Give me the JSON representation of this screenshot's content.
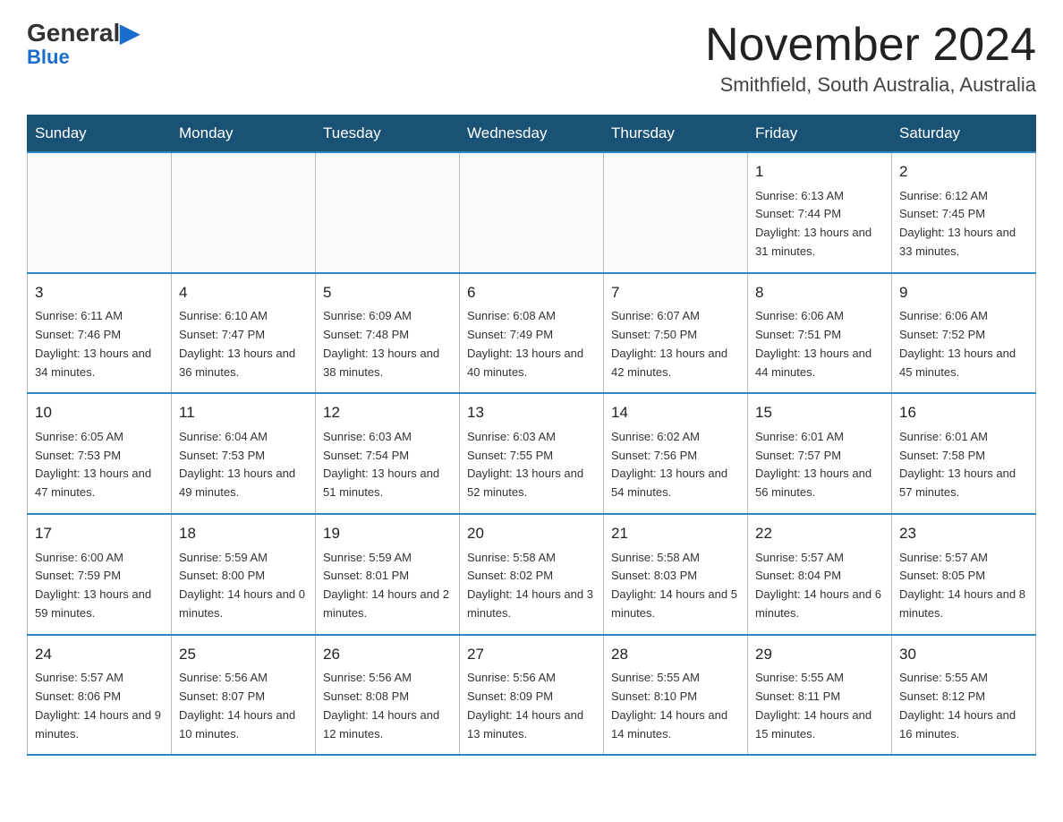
{
  "header": {
    "logo_general": "General",
    "logo_blue": "Blue",
    "month_title": "November 2024",
    "location": "Smithfield, South Australia, Australia"
  },
  "days_of_week": [
    "Sunday",
    "Monday",
    "Tuesday",
    "Wednesday",
    "Thursday",
    "Friday",
    "Saturday"
  ],
  "weeks": [
    [
      {
        "day": "",
        "info": ""
      },
      {
        "day": "",
        "info": ""
      },
      {
        "day": "",
        "info": ""
      },
      {
        "day": "",
        "info": ""
      },
      {
        "day": "",
        "info": ""
      },
      {
        "day": "1",
        "info": "Sunrise: 6:13 AM\nSunset: 7:44 PM\nDaylight: 13 hours and 31 minutes."
      },
      {
        "day": "2",
        "info": "Sunrise: 6:12 AM\nSunset: 7:45 PM\nDaylight: 13 hours and 33 minutes."
      }
    ],
    [
      {
        "day": "3",
        "info": "Sunrise: 6:11 AM\nSunset: 7:46 PM\nDaylight: 13 hours and 34 minutes."
      },
      {
        "day": "4",
        "info": "Sunrise: 6:10 AM\nSunset: 7:47 PM\nDaylight: 13 hours and 36 minutes."
      },
      {
        "day": "5",
        "info": "Sunrise: 6:09 AM\nSunset: 7:48 PM\nDaylight: 13 hours and 38 minutes."
      },
      {
        "day": "6",
        "info": "Sunrise: 6:08 AM\nSunset: 7:49 PM\nDaylight: 13 hours and 40 minutes."
      },
      {
        "day": "7",
        "info": "Sunrise: 6:07 AM\nSunset: 7:50 PM\nDaylight: 13 hours and 42 minutes."
      },
      {
        "day": "8",
        "info": "Sunrise: 6:06 AM\nSunset: 7:51 PM\nDaylight: 13 hours and 44 minutes."
      },
      {
        "day": "9",
        "info": "Sunrise: 6:06 AM\nSunset: 7:52 PM\nDaylight: 13 hours and 45 minutes."
      }
    ],
    [
      {
        "day": "10",
        "info": "Sunrise: 6:05 AM\nSunset: 7:53 PM\nDaylight: 13 hours and 47 minutes."
      },
      {
        "day": "11",
        "info": "Sunrise: 6:04 AM\nSunset: 7:53 PM\nDaylight: 13 hours and 49 minutes."
      },
      {
        "day": "12",
        "info": "Sunrise: 6:03 AM\nSunset: 7:54 PM\nDaylight: 13 hours and 51 minutes."
      },
      {
        "day": "13",
        "info": "Sunrise: 6:03 AM\nSunset: 7:55 PM\nDaylight: 13 hours and 52 minutes."
      },
      {
        "day": "14",
        "info": "Sunrise: 6:02 AM\nSunset: 7:56 PM\nDaylight: 13 hours and 54 minutes."
      },
      {
        "day": "15",
        "info": "Sunrise: 6:01 AM\nSunset: 7:57 PM\nDaylight: 13 hours and 56 minutes."
      },
      {
        "day": "16",
        "info": "Sunrise: 6:01 AM\nSunset: 7:58 PM\nDaylight: 13 hours and 57 minutes."
      }
    ],
    [
      {
        "day": "17",
        "info": "Sunrise: 6:00 AM\nSunset: 7:59 PM\nDaylight: 13 hours and 59 minutes."
      },
      {
        "day": "18",
        "info": "Sunrise: 5:59 AM\nSunset: 8:00 PM\nDaylight: 14 hours and 0 minutes."
      },
      {
        "day": "19",
        "info": "Sunrise: 5:59 AM\nSunset: 8:01 PM\nDaylight: 14 hours and 2 minutes."
      },
      {
        "day": "20",
        "info": "Sunrise: 5:58 AM\nSunset: 8:02 PM\nDaylight: 14 hours and 3 minutes."
      },
      {
        "day": "21",
        "info": "Sunrise: 5:58 AM\nSunset: 8:03 PM\nDaylight: 14 hours and 5 minutes."
      },
      {
        "day": "22",
        "info": "Sunrise: 5:57 AM\nSunset: 8:04 PM\nDaylight: 14 hours and 6 minutes."
      },
      {
        "day": "23",
        "info": "Sunrise: 5:57 AM\nSunset: 8:05 PM\nDaylight: 14 hours and 8 minutes."
      }
    ],
    [
      {
        "day": "24",
        "info": "Sunrise: 5:57 AM\nSunset: 8:06 PM\nDaylight: 14 hours and 9 minutes."
      },
      {
        "day": "25",
        "info": "Sunrise: 5:56 AM\nSunset: 8:07 PM\nDaylight: 14 hours and 10 minutes."
      },
      {
        "day": "26",
        "info": "Sunrise: 5:56 AM\nSunset: 8:08 PM\nDaylight: 14 hours and 12 minutes."
      },
      {
        "day": "27",
        "info": "Sunrise: 5:56 AM\nSunset: 8:09 PM\nDaylight: 14 hours and 13 minutes."
      },
      {
        "day": "28",
        "info": "Sunrise: 5:55 AM\nSunset: 8:10 PM\nDaylight: 14 hours and 14 minutes."
      },
      {
        "day": "29",
        "info": "Sunrise: 5:55 AM\nSunset: 8:11 PM\nDaylight: 14 hours and 15 minutes."
      },
      {
        "day": "30",
        "info": "Sunrise: 5:55 AM\nSunset: 8:12 PM\nDaylight: 14 hours and 16 minutes."
      }
    ]
  ]
}
